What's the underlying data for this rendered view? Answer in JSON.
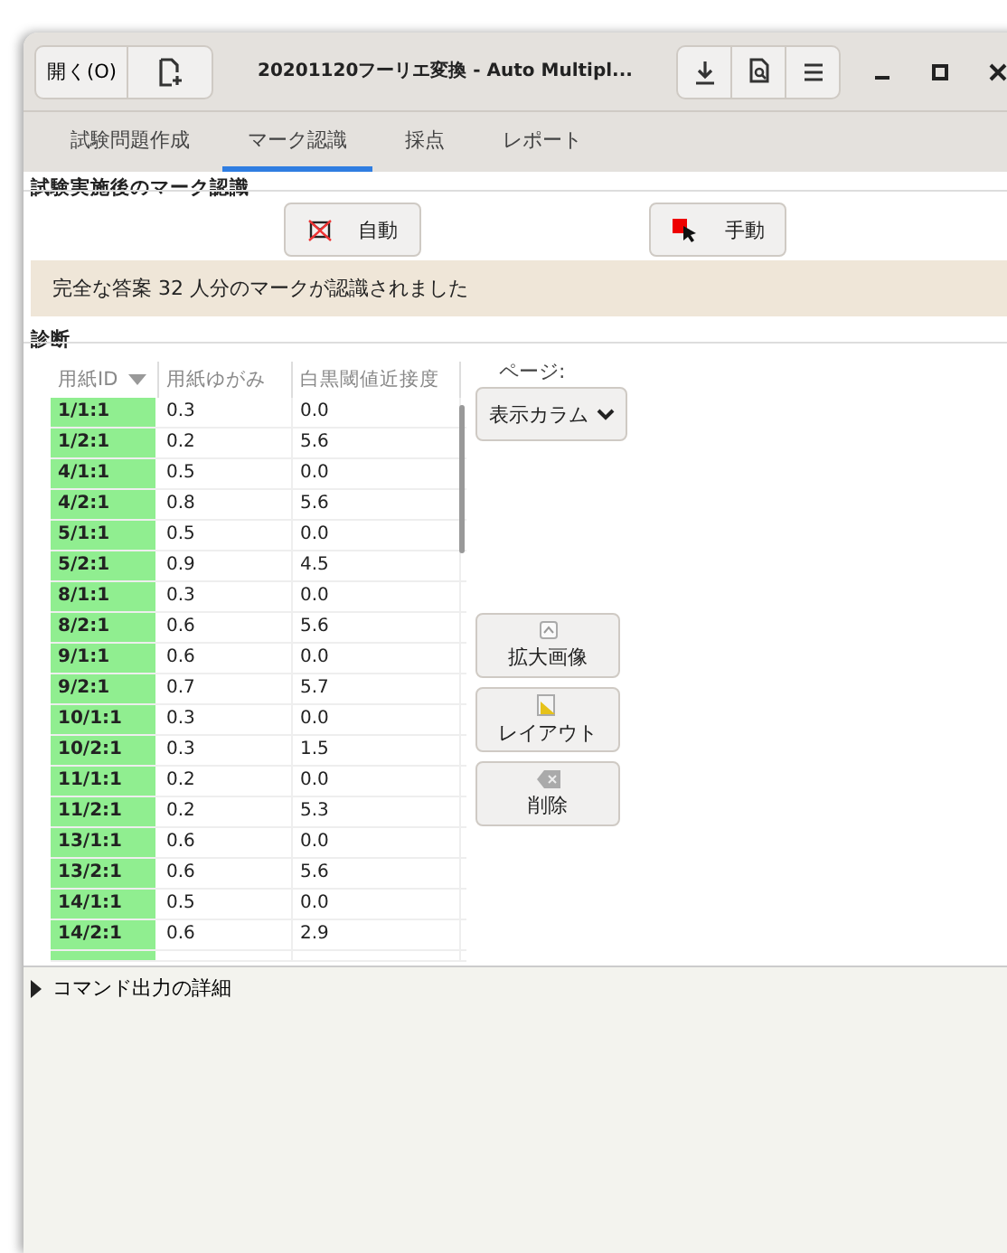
{
  "header": {
    "open_button": "開く(O)",
    "title": "20201120フーリエ変換 - Auto Multipl..."
  },
  "tabs": [
    {
      "label": "試験問題作成",
      "selected": false
    },
    {
      "label": "マーク認識",
      "selected": true
    },
    {
      "label": "採点",
      "selected": false
    },
    {
      "label": "レポート",
      "selected": false
    }
  ],
  "recognition": {
    "title": "試験実施後のマーク認識",
    "auto_button": "自動",
    "manual_button": "手動",
    "message": "完全な答案 32 人分のマークが認識されました"
  },
  "diagnosis": {
    "title": "診断",
    "page_label": "ページ:",
    "columns_button": "表示カラム",
    "columns": [
      {
        "label": "用紙ID",
        "sorted": true
      },
      {
        "label": "用紙ゆがみ",
        "sorted": false
      },
      {
        "label": "白黒閾値近接度",
        "sorted": false
      }
    ],
    "rows": [
      [
        "1/1:1",
        "0.3",
        "0.0"
      ],
      [
        "1/2:1",
        "0.2",
        "5.6"
      ],
      [
        "4/1:1",
        "0.5",
        "0.0"
      ],
      [
        "4/2:1",
        "0.8",
        "5.6"
      ],
      [
        "5/1:1",
        "0.5",
        "0.0"
      ],
      [
        "5/2:1",
        "0.9",
        "4.5"
      ],
      [
        "8/1:1",
        "0.3",
        "0.0"
      ],
      [
        "8/2:1",
        "0.6",
        "5.6"
      ],
      [
        "9/1:1",
        "0.6",
        "0.0"
      ],
      [
        "9/2:1",
        "0.7",
        "5.7"
      ],
      [
        "10/1:1",
        "0.3",
        "0.0"
      ],
      [
        "10/2:1",
        "0.3",
        "1.5"
      ],
      [
        "11/1:1",
        "0.2",
        "0.0"
      ],
      [
        "11/2:1",
        "0.2",
        "5.3"
      ],
      [
        "13/1:1",
        "0.6",
        "0.0"
      ],
      [
        "13/2:1",
        "0.6",
        "5.6"
      ],
      [
        "14/1:1",
        "0.5",
        "0.0"
      ],
      [
        "14/2:1",
        "0.6",
        "2.9"
      ]
    ],
    "side_buttons": [
      {
        "kind": "zoom",
        "label": "拡大画像"
      },
      {
        "kind": "layout",
        "label": "レイアウト"
      },
      {
        "kind": "delete",
        "label": "削除"
      }
    ]
  },
  "command_output": {
    "label": "コマンド出力の詳細",
    "expanded": false
  }
}
